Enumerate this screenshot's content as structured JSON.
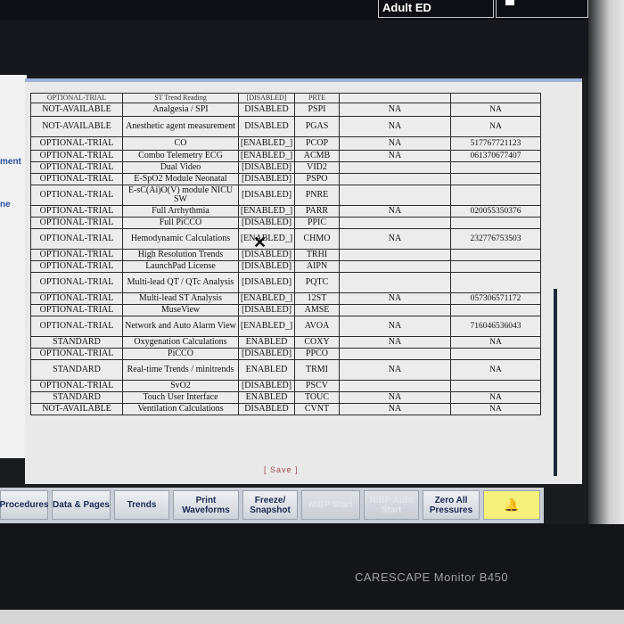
{
  "header": {
    "patient_category": "Adult ED"
  },
  "left_fragments": [
    "ment",
    "ne"
  ],
  "table": {
    "cut_row": [
      "OPTIONAL-TRIAL",
      "ST Trend Reading",
      "[DISABLED]",
      "PRTE"
    ],
    "rows": [
      [
        "NOT-AVAILABLE",
        "Analgesia / SPI",
        "DISABLED",
        "PSPI",
        "NA",
        "NA"
      ],
      [
        "NOT-AVAILABLE",
        "Anesthetic agent measurement",
        "DISABLED",
        "PGAS",
        "NA",
        "NA"
      ],
      [
        "OPTIONAL-TRIAL",
        "CO",
        "[ENABLED_]",
        "PCOP",
        "NA",
        "517767721123"
      ],
      [
        "OPTIONAL-TRIAL",
        "Combo Telemetry ECG",
        "[ENABLED_]",
        "ACMB",
        "NA",
        "061370677407"
      ],
      [
        "OPTIONAL-TRIAL",
        "Dual Video",
        "[DISABLED]",
        "VID2",
        "",
        ""
      ],
      [
        "OPTIONAL-TRIAL",
        "E-SpO2 Module Neonatal",
        "[DISABLED]",
        "PSPO",
        "",
        ""
      ],
      [
        "OPTIONAL-TRIAL",
        "E-sC(Ai)O(V) module NICU SW",
        "[DISABLED]",
        "PNRE",
        "",
        ""
      ],
      [
        "OPTIONAL-TRIAL",
        "Full Arrhythmia",
        "[ENABLED_]",
        "PARR",
        "NA",
        "020055350376"
      ],
      [
        "OPTIONAL-TRIAL",
        "Full PiCCO",
        "[DISABLED]",
        "PPIC",
        "",
        ""
      ],
      [
        "OPTIONAL-TRIAL",
        "Hemodynamic Calculations",
        "[ENABLED_]",
        "CHMO",
        "NA",
        "232776753503"
      ],
      [
        "OPTIONAL-TRIAL",
        "High Resolution Trends",
        "[DISABLED]",
        "TRHI",
        "",
        ""
      ],
      [
        "OPTIONAL-TRIAL",
        "LaunchPad License",
        "[DISABLED]",
        "AIPN",
        "",
        ""
      ],
      [
        "OPTIONAL-TRIAL",
        "Multi-lead QT / QTc Analysis",
        "[DISABLED]",
        "PQTC",
        "",
        ""
      ],
      [
        "OPTIONAL-TRIAL",
        "Multi-lead ST Analysis",
        "[ENABLED_]",
        "12ST",
        "NA",
        "057306571172"
      ],
      [
        "OPTIONAL-TRIAL",
        "MuseView",
        "[DISABLED]",
        "AMSE",
        "",
        ""
      ],
      [
        "OPTIONAL-TRIAL",
        "Network and Auto Alarm View",
        "[ENABLED_]",
        "AVOA",
        "NA",
        "716046536043"
      ],
      [
        "STANDARD",
        "Oxygenation Calculations",
        "ENABLED",
        "COXY",
        "NA",
        "NA"
      ],
      [
        "OPTIONAL-TRIAL",
        "PiCCO",
        "[DISABLED]",
        "PPCO",
        "",
        ""
      ],
      [
        "STANDARD",
        "Real-time Trends / minitrends",
        "ENABLED",
        "TRMI",
        "NA",
        "NA"
      ],
      [
        "OPTIONAL-TRIAL",
        "SvO2",
        "[DISABLED]",
        "PSCV",
        "",
        ""
      ],
      [
        "STANDARD",
        "Touch User Interface",
        "ENABLED",
        "TOUC",
        "NA",
        "NA"
      ],
      [
        "NOT-AVAILABLE",
        "Ventilation Calculations",
        "DISABLED",
        "CVNT",
        "NA",
        "NA"
      ]
    ]
  },
  "save_label": "[ Save ]",
  "toolbar": {
    "procedures": "Procedures",
    "data_pages": "Data & Pages",
    "trends": "Trends",
    "print_waveforms": "Print Waveforms",
    "freeze_snapshot": "Freeze/ Snapshot",
    "nibp_start": "NIBP Start",
    "nibp_auto_start": "NIBP Auto Start",
    "zero_all_pressures": "Zero All Pressures",
    "alarm_icon": "bell-icon"
  },
  "device_label": "CARESCAPE Monitor B450",
  "colors": {
    "dialog_accent": "#9fb4d6",
    "alarm_button": "#f4f27a",
    "toolbar_text": "#1a2a55"
  }
}
